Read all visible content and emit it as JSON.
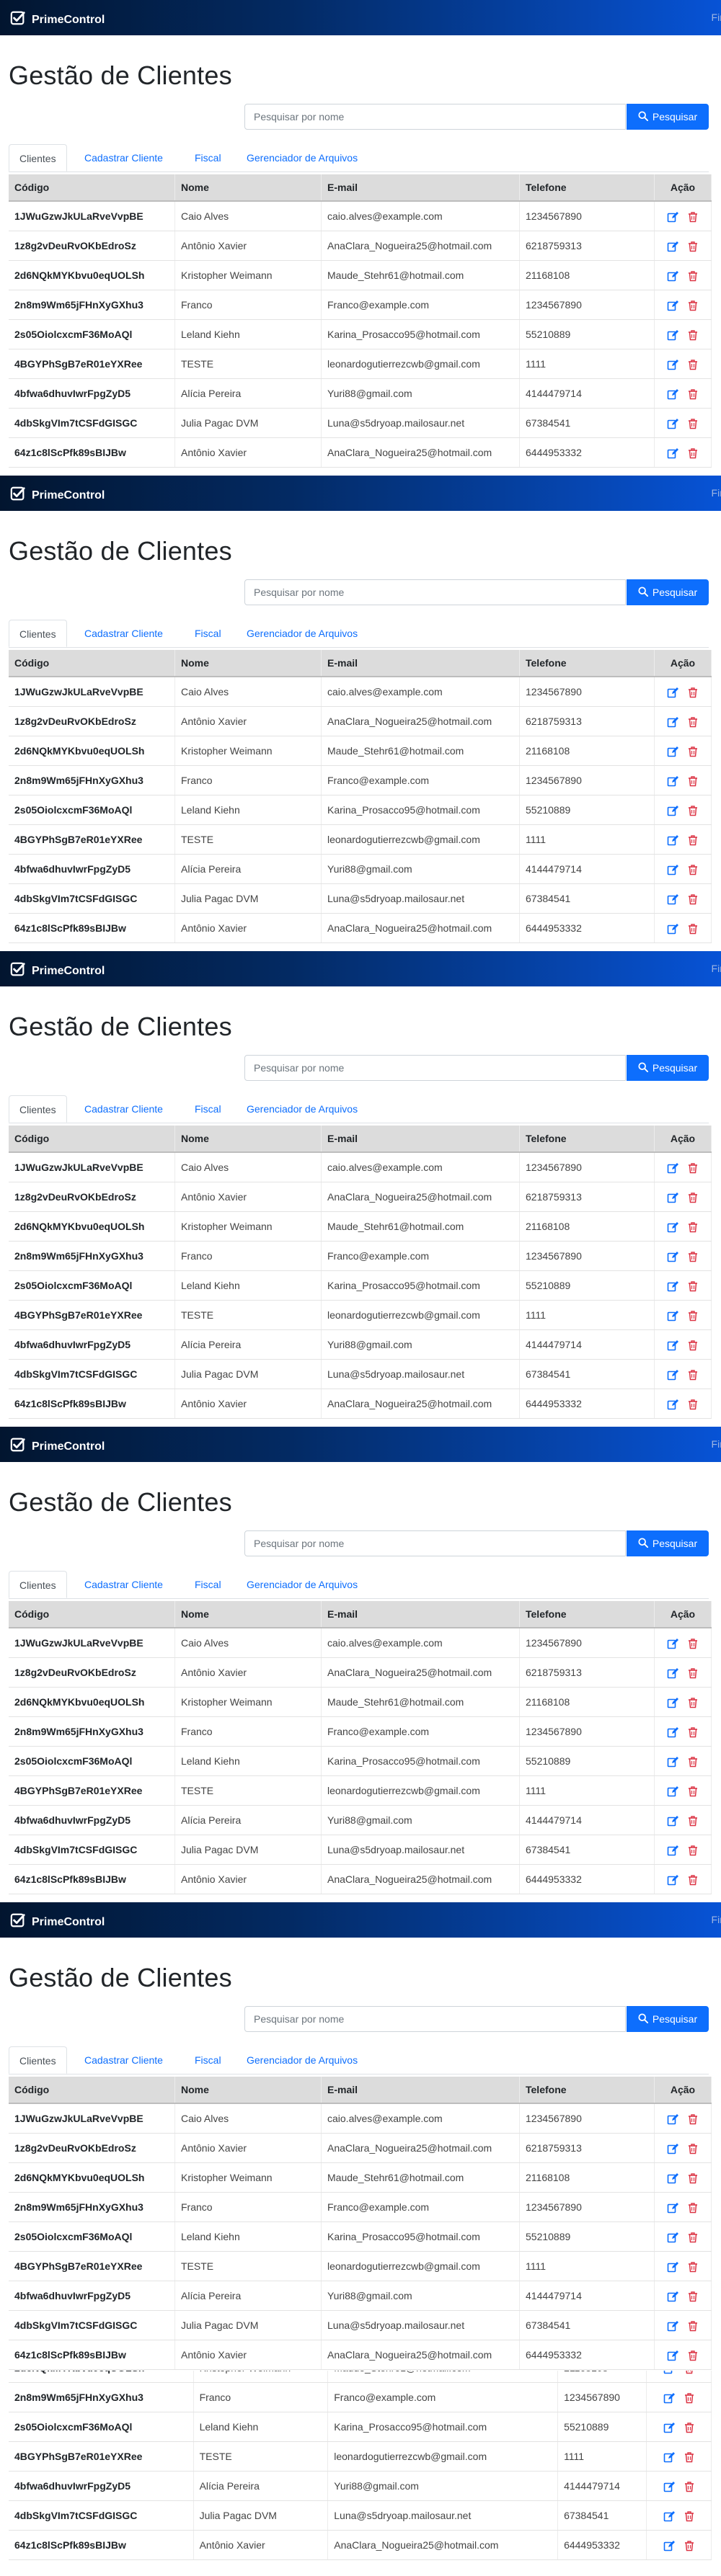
{
  "navbar": {
    "brand": "PrimeControl",
    "right_text": "Fin"
  },
  "page": {
    "title": "Gestão de Clientes"
  },
  "search": {
    "placeholder": "Pesquisar por nome",
    "button_label": "Pesquisar"
  },
  "tabs": [
    {
      "label": "Clientes",
      "active": true
    },
    {
      "label": "Cadastrar Cliente",
      "active": false
    },
    {
      "label": "Fiscal",
      "active": false
    },
    {
      "label": "Gerenciador de Arquivos",
      "active": false
    }
  ],
  "table": {
    "headers": [
      "Código",
      "Nome",
      "E-mail",
      "Telefone",
      "Ação"
    ],
    "rows": [
      [
        "1JWuGzwJkULaRveVvpBE",
        "Caio Alves",
        "caio.alves@example.com",
        "1234567890"
      ],
      [
        "1z8g2vDeuRvOKbEdroSz",
        "Antônio Xavier",
        "AnaClara_Nogueira25@hotmail.com",
        "6218759313"
      ],
      [
        "2d6NQkMYKbvu0eqUOLSh",
        "Kristopher Weimann",
        "Maude_Stehr61@hotmail.com",
        "21168108"
      ],
      [
        "2n8m9Wm65jFHnXyGXhu3",
        "Franco",
        "Franco@example.com",
        "1234567890"
      ],
      [
        "2s05OiolcxcmF36MoAQl",
        "Leland Kiehn",
        "Karina_Prosacco95@hotmail.com",
        "55210889"
      ],
      [
        "4BGYPhSgB7eR01eYXRee",
        "TESTE",
        "leonardogutierrezcwb@gmail.com",
        "1111"
      ],
      [
        "4bfwa6dhuvIwrFpgZyD5",
        "Alícia Pereira",
        "Yuri88@gmail.com",
        "4144479714"
      ],
      [
        "4dbSkgVIm7tCSFdGISGC",
        "Julia Pagac DVM",
        "Luna@s5dryoap.mailosaur.net",
        "67384541"
      ],
      [
        "64z1c8lScPfk89sBIJBw",
        "Antônio Xavier",
        "AnaClara_Nogueira25@hotmail.com",
        "6444953332"
      ]
    ]
  },
  "icons": {
    "edit": "edit-icon",
    "delete": "trash-icon",
    "logo": "checkbox-logo-icon",
    "search": "search-icon"
  },
  "colors": {
    "primary": "#0d6efd",
    "navbar_dark": "#02152f",
    "delete": "#dc3545"
  }
}
